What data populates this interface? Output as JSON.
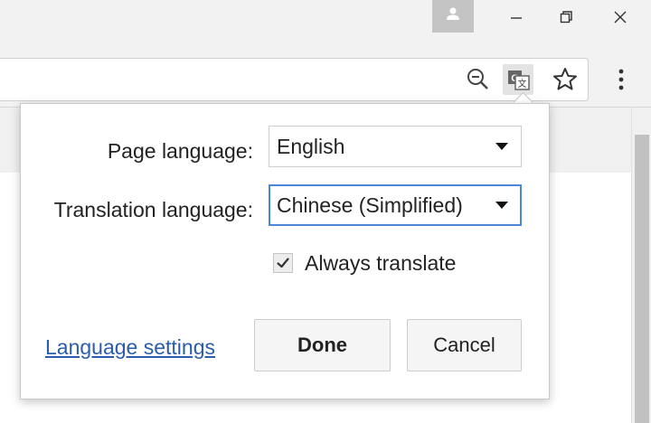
{
  "titlebar": {
    "profile_icon": "person-icon",
    "minimize_icon": "minimize-icon",
    "restore_icon": "restore-icon",
    "close_icon": "close-icon"
  },
  "toolbar": {
    "zoom_icon": "zoom-out-icon",
    "translate_icon": "translate-icon",
    "bookmark_icon": "star-icon",
    "menu_icon": "more-vertical-icon"
  },
  "translate_bubble": {
    "page_language_label": "Page language:",
    "page_language_value": "English",
    "translation_language_label": "Translation language:",
    "translation_language_value": "Chinese (Simplified)",
    "always_translate_label": "Always translate",
    "always_translate_checked": true,
    "language_settings_link": "Language settings",
    "done_label": "Done",
    "cancel_label": "Cancel"
  },
  "colors": {
    "link": "#2a5db0",
    "focus_border": "#4a86d9",
    "chrome_bg": "#f2f2f2"
  }
}
